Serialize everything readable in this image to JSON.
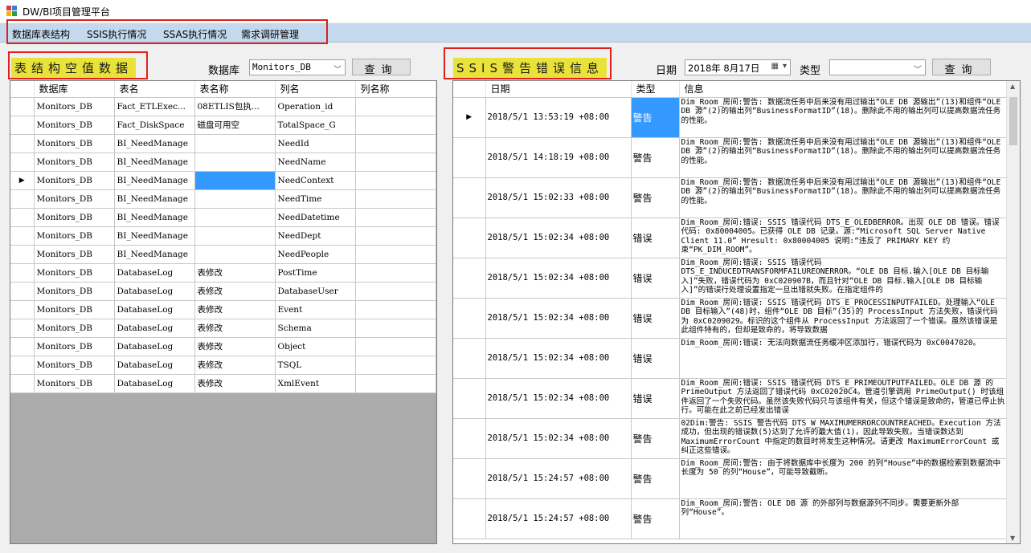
{
  "window": {
    "title": "DW/BI项目管理平台"
  },
  "menu": {
    "items": [
      "数据库表结构",
      "SSIS执行情况",
      "SSAS执行情况",
      "需求调研管理"
    ]
  },
  "left_panel": {
    "title": "表结构空值数据",
    "db_label": "数据库",
    "db_value": "Monitors_DB",
    "query_button": "查询",
    "columns": [
      "数据库",
      "表名",
      "表名称",
      "列名",
      "列名称"
    ],
    "rows": [
      [
        "Monitors_DB",
        "Fact_ETLExec...",
        "08ETLIS包执...",
        "Operation_id",
        ""
      ],
      [
        "Monitors_DB",
        "Fact_DiskSpace",
        "磁盘可用空",
        "TotalSpace_G",
        ""
      ],
      [
        "Monitors_DB",
        "BI_NeedManage",
        "",
        "NeedId",
        ""
      ],
      [
        "Monitors_DB",
        "BI_NeedManage",
        "",
        "NeedName",
        ""
      ],
      [
        "Monitors_DB",
        "BI_NeedManage",
        "",
        "NeedContext",
        ""
      ],
      [
        "Monitors_DB",
        "BI_NeedManage",
        "",
        "NeedTime",
        ""
      ],
      [
        "Monitors_DB",
        "BI_NeedManage",
        "",
        "NeedDatetime",
        ""
      ],
      [
        "Monitors_DB",
        "BI_NeedManage",
        "",
        "NeedDept",
        ""
      ],
      [
        "Monitors_DB",
        "BI_NeedManage",
        "",
        "NeedPeople",
        ""
      ],
      [
        "Monitors_DB",
        "DatabaseLog",
        "表修改",
        "PostTime",
        ""
      ],
      [
        "Monitors_DB",
        "DatabaseLog",
        "表修改",
        "DatabaseUser",
        ""
      ],
      [
        "Monitors_DB",
        "DatabaseLog",
        "表修改",
        "Event",
        ""
      ],
      [
        "Monitors_DB",
        "DatabaseLog",
        "表修改",
        "Schema",
        ""
      ],
      [
        "Monitors_DB",
        "DatabaseLog",
        "表修改",
        "Object",
        ""
      ],
      [
        "Monitors_DB",
        "DatabaseLog",
        "表修改",
        "TSQL",
        ""
      ],
      [
        "Monitors_DB",
        "DatabaseLog",
        "表修改",
        "XmlEvent",
        ""
      ]
    ],
    "current_row_marker": "▶"
  },
  "right_panel": {
    "title": "SSIS警告错误信息",
    "date_label": "日期",
    "date_value": "2018年 8月17日",
    "type_label": "类型",
    "type_value": "",
    "query_button": "查询",
    "columns": [
      "日期",
      "类型",
      "信息"
    ],
    "rows": [
      [
        "2018/5/1 13:53:19 +08:00",
        "警告",
        "Dim_Room_房间:警告: 数据流任务中后来没有用过输出“OLE DB 源输出”(13)和组件“OLE DB 源”(2)的输出列“BusinessFormatID”(18)。删除此不用的输出列可以提高数据流任务的性能。"
      ],
      [
        "2018/5/1 14:18:19 +08:00",
        "警告",
        "Dim_Room_房间:警告: 数据流任务中后来没有用过输出“OLE DB 源输出”(13)和组件“OLE DB 源”(2)的输出列“BusinessFormatID”(18)。删除此不用的输出列可以提高数据流任务的性能。"
      ],
      [
        "2018/5/1 15:02:33 +08:00",
        "警告",
        "Dim_Room_房间:警告: 数据流任务中后来没有用过输出“OLE DB 源输出”(13)和组件“OLE DB 源”(2)的输出列“BusinessFormatID”(18)。删除此不用的输出列可以提高数据流任务的性能。"
      ],
      [
        "2018/5/1 15:02:34 +08:00",
        "错误",
        "Dim_Room_房间:错误: SSIS 错误代码 DTS_E_OLEDBERROR。出现 OLE DB 错误。错误代码: 0x80004005。已获得 OLE DB 记录。源:“Microsoft SQL Server Native Client 11.0” Hresult: 0x80004005 说明:“违反了 PRIMARY KEY 约束“PK_DIM_ROOM”。"
      ],
      [
        "2018/5/1 15:02:34 +08:00",
        "错误",
        "Dim_Room_房间:错误: SSIS 错误代码 DTS_E_INDUCEDTRANSFORMFAILUREONERROR。“OLE DB 目标.输入[OLE DB 目标输入]”失败，错误代码为 0xC020907B，而且针对“OLE DB 目标.输入[OLE DB 目标输入]”的错误行处理设置指定一旦出错就失败。在指定组件的"
      ],
      [
        "2018/5/1 15:02:34 +08:00",
        "错误",
        "Dim_Room_房间:错误: SSIS 错误代码 DTS_E_PROCESSINPUTFAILED。处理输入“OLE DB 目标输入”(48)时，组件“OLE DB 目标”(35)的 ProcessInput 方法失败，错误代码为 0xC0209029。标识的这个组件从 ProcessInput 方法返回了一个错误。虽然该错误是此组件特有的，但却是致命的，将导致数据"
      ],
      [
        "2018/5/1 15:02:34 +08:00",
        "错误",
        "Dim_Room_房间:错误: 无法向数据流任务缓冲区添加行，错误代码为 0xC0047020。"
      ],
      [
        "2018/5/1 15:02:34 +08:00",
        "错误",
        "Dim_Room_房间:错误: SSIS 错误代码 DTS_E_PRIMEOUTPUTFAILED。OLE DB 源 的 PrimeOutput 方法返回了错误代码 0xC02020C4。管道引擎调用 PrimeOutput() 时该组件返回了一个失败代码。虽然该失败代码只与该组件有关，但这个错误是致命的，管道已停止执行。可能在此之前已经发出错误"
      ],
      [
        "2018/5/1 15:02:34 +08:00",
        "警告",
        "02Dim:警告: SSIS 警告代码 DTS_W_MAXIMUMERRORCOUNTREACHED。Execution 方法成功，但出现的错误数(5)达到了允许的最大值(1)，因此导致失败。当错误数达到 MaximumErrorCount 中指定的数目时将发生这种情况。请更改 MaximumErrorCount 或纠正这些错误。"
      ],
      [
        "2018/5/1 15:24:57 +08:00",
        "警告",
        "Dim_Room_房间:警告: 由于将数据库中长度为 200 的列“House”中的数据检索到数据流中长度为 50 的列“House”，可能导致截断。"
      ],
      [
        "2018/5/1 15:24:57 +08:00",
        "警告",
        "Dim_Room_房间:警告: OLE DB 源 的外部列与数据源列不同步。需要更新外部列“House”。"
      ]
    ],
    "current_row_marker": "▶"
  },
  "colors": {
    "highlight": "#3399ff",
    "menubar": "#c4d9ee",
    "title_bg": "#e9e23a",
    "annotation": "#e0201a"
  }
}
